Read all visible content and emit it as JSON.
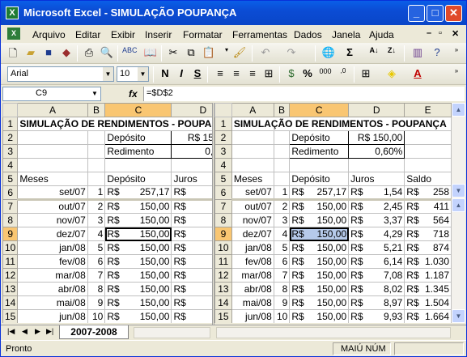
{
  "window": {
    "title": "Microsoft Excel - SIMULAÇÃO POUPANÇA"
  },
  "menu": [
    "Arquivo",
    "Editar",
    "Exibir",
    "Inserir",
    "Formatar",
    "Ferramentas",
    "Dados",
    "Janela",
    "Ajuda"
  ],
  "formatting": {
    "font": "Arial",
    "size": "10"
  },
  "formula_bar": {
    "cell": "C9",
    "formula": "=$D$2",
    "fx": "fx"
  },
  "columns_left": [
    "A",
    "B",
    "C",
    "D"
  ],
  "columns_right": [
    "A",
    "B",
    "C",
    "D",
    "E"
  ],
  "rows": [
    {
      "n": "1",
      "a": "SIMULAÇÃO DE RENDIMENTOS - POUPANÇA"
    },
    {
      "n": "2",
      "c": "Depósito",
      "d": "R$ 150,00"
    },
    {
      "n": "3",
      "c": "Redimento",
      "d": "0,60%"
    },
    {
      "n": "4"
    },
    {
      "n": "5",
      "a": "Meses",
      "c": "Depósito",
      "d": "Juros",
      "e": "Saldo"
    },
    {
      "n": "6",
      "a": "set/07",
      "b": "1",
      "c": "257,17",
      "d": "1,54",
      "e": "258"
    },
    {
      "n": "7",
      "a": "out/07",
      "b": "2",
      "c": "150,00",
      "d": "2,45",
      "e": "411"
    },
    {
      "n": "8",
      "a": "nov/07",
      "b": "3",
      "c": "150,00",
      "d": "3,37",
      "e": "564"
    },
    {
      "n": "9",
      "a": "dez/07",
      "b": "4",
      "c": "150,00",
      "d": "4,29",
      "e": "718"
    },
    {
      "n": "10",
      "a": "jan/08",
      "b": "5",
      "c": "150,00",
      "d": "5,21",
      "e": "874"
    },
    {
      "n": "11",
      "a": "fev/08",
      "b": "6",
      "c": "150,00",
      "d": "6,14",
      "e": "1.030"
    },
    {
      "n": "12",
      "a": "mar/08",
      "b": "7",
      "c": "150,00",
      "d": "7,08",
      "e": "1.187"
    },
    {
      "n": "13",
      "a": "abr/08",
      "b": "8",
      "c": "150,00",
      "d": "8,02",
      "e": "1.345"
    },
    {
      "n": "14",
      "a": "mai/08",
      "b": "9",
      "c": "150,00",
      "d": "8,97",
      "e": "1.504"
    },
    {
      "n": "15",
      "a": "jun/08",
      "b": "10",
      "c": "150,00",
      "d": "9,93",
      "e": "1.664"
    }
  ],
  "currency": "R$",
  "sheet_tab": "2007-2008",
  "status": {
    "left": "Pronto",
    "caps": "MAIÚ NÚM"
  }
}
